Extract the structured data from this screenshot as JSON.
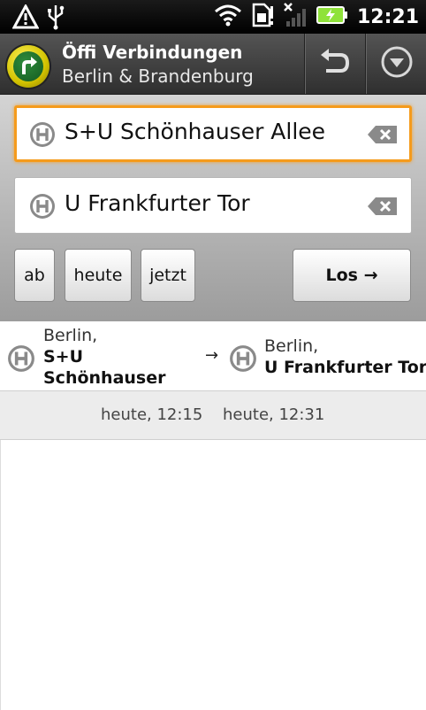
{
  "status_bar": {
    "time": "12:21",
    "icons": [
      "warning-icon",
      "usb-icon",
      "wifi-icon",
      "sim-icon",
      "no-signal-icon",
      "battery-charging-icon"
    ]
  },
  "title_bar": {
    "title": "Öffi Verbindungen",
    "subtitle": "Berlin & Brandenburg",
    "icons": [
      "app-logo-icon",
      "undo-icon",
      "dropdown-icon"
    ]
  },
  "form": {
    "from_value": "S+U Schönhauser Allee",
    "to_value": "U Frankfurter Tor",
    "buttons": {
      "ab": "ab",
      "heute": "heute",
      "jetzt": "jetzt",
      "los": "Los →"
    }
  },
  "route": {
    "from_city": "Berlin,",
    "from_name": "S+U Schönhauser Allee",
    "arrow": "→",
    "to_city": "Berlin,",
    "to_name": "U Frankfurter Tor"
  },
  "trip": {
    "departure": "heute, 12:15",
    "arrival": "heute, 12:31"
  },
  "colors": {
    "focus_border": "#f59b1c",
    "title_bar": "#3f3f3f",
    "form_background": "#bdbdbd"
  }
}
